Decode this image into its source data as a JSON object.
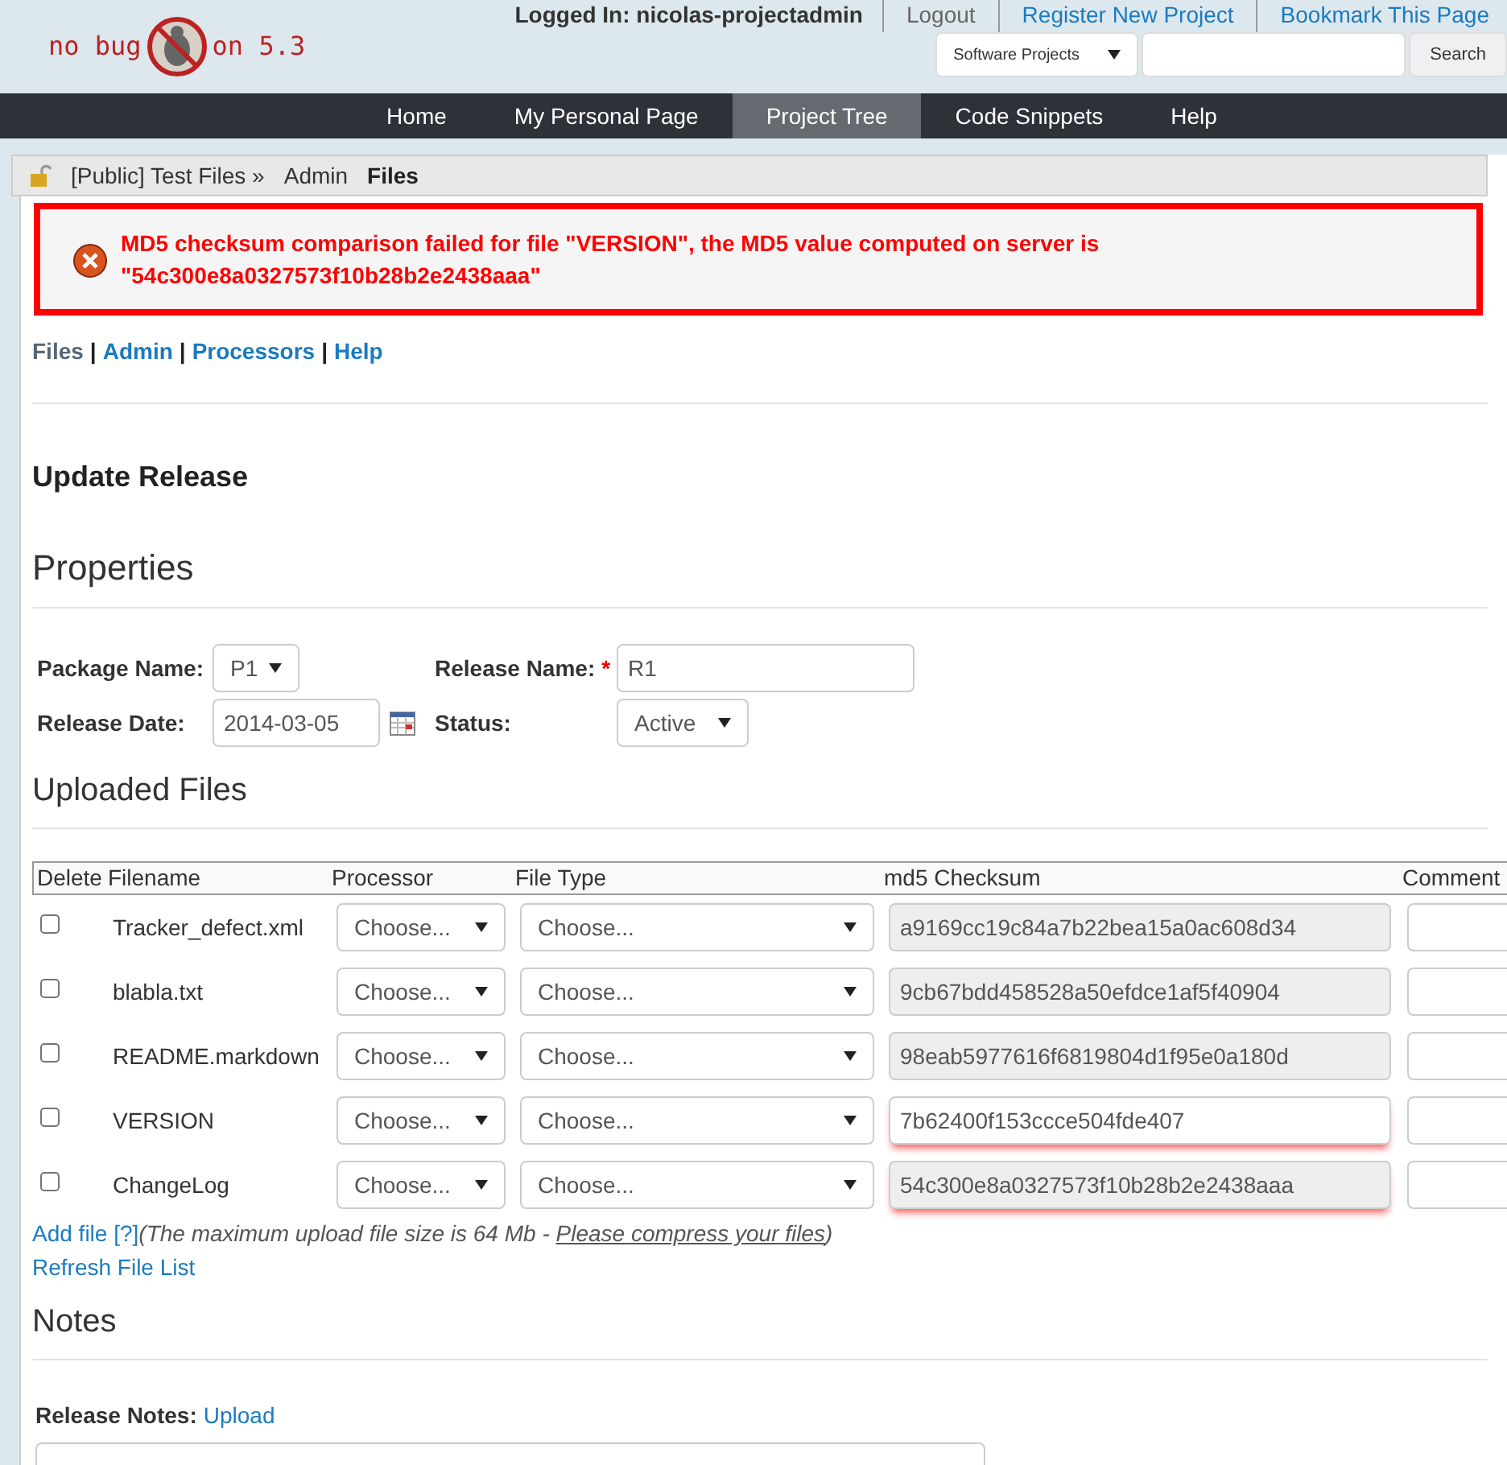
{
  "logo": {
    "left": "no bug",
    "right": "on 5.3"
  },
  "user_bar": {
    "logged_in": "Logged In: nicolas-projectadmin",
    "links": [
      "Logout",
      "Register New Project",
      "Bookmark This Page"
    ]
  },
  "search": {
    "scope": "Software Projects",
    "button": "Search"
  },
  "nav": [
    {
      "label": "Home",
      "selected": false
    },
    {
      "label": "My Personal Page",
      "selected": false
    },
    {
      "label": "Project Tree",
      "selected": true
    },
    {
      "label": "Code Snippets",
      "selected": false
    },
    {
      "label": "Help",
      "selected": false
    }
  ],
  "breadcrumb": [
    "[Public] Test Files »",
    "Admin",
    "Files"
  ],
  "error": {
    "line1": "MD5 checksum comparison failed for file \"VERSION\", the MD5 value computed on server is",
    "line2": "\"54c300e8a0327573f10b28b2e2438aaa\""
  },
  "subnav_separator": "|",
  "subnav": [
    {
      "label": "Files",
      "selected": true
    },
    {
      "label": "Admin",
      "selected": false
    },
    {
      "label": "Processors",
      "selected": false
    },
    {
      "label": "Help",
      "selected": false
    }
  ],
  "page_title": "Update Release",
  "properties": {
    "heading": "Properties",
    "package_label": "Package Name:",
    "package_value": "P1",
    "release_name_label": "Release Name:",
    "required_mark": "*",
    "release_name_value": "R1",
    "date_label": "Release Date:",
    "date_value": "2014-03-05",
    "status_label": "Status:",
    "status_value": "Active"
  },
  "uploaded": {
    "heading": "Uploaded Files",
    "columns": [
      "Delete",
      "Filename",
      "Processor",
      "File Type",
      "md5 Checksum",
      "Comment"
    ],
    "rows": [
      {
        "checked": false,
        "filename": "Tracker_defect.xml",
        "processor": "Choose...",
        "file_type": "Choose...",
        "checksum": "a9169cc19c84a7b22bea15a0ac608d34",
        "readonly": true,
        "invalid": false
      },
      {
        "checked": false,
        "filename": "blabla.txt",
        "processor": "Choose...",
        "file_type": "Choose...",
        "checksum": "9cb67bdd458528a50efdce1af5f40904",
        "readonly": true,
        "invalid": false
      },
      {
        "checked": false,
        "filename": "README.markdown",
        "processor": "Choose...",
        "file_type": "Choose...",
        "checksum": "98eab5977616f6819804d1f95e0a180d",
        "readonly": true,
        "invalid": false
      },
      {
        "checked": false,
        "filename": "VERSION",
        "processor": "Choose...",
        "file_type": "Choose...",
        "checksum": "7b62400f153ccce504fde407",
        "readonly": false,
        "invalid": true
      },
      {
        "checked": false,
        "filename": "ChangeLog",
        "processor": "Choose...",
        "file_type": "Choose...",
        "checksum": "54c300e8a0327573f10b28b2e2438aaa",
        "readonly": true,
        "invalid": true
      }
    ],
    "add_file": "Add file [?]",
    "note_open": "(The maximum upload file size is 64 Mb - ",
    "note_link": "Please compress your files",
    "note_close": ")",
    "refresh": "Refresh File List"
  },
  "notes": {
    "heading": "Notes",
    "label": "Release Notes:",
    "upload": "Upload"
  }
}
